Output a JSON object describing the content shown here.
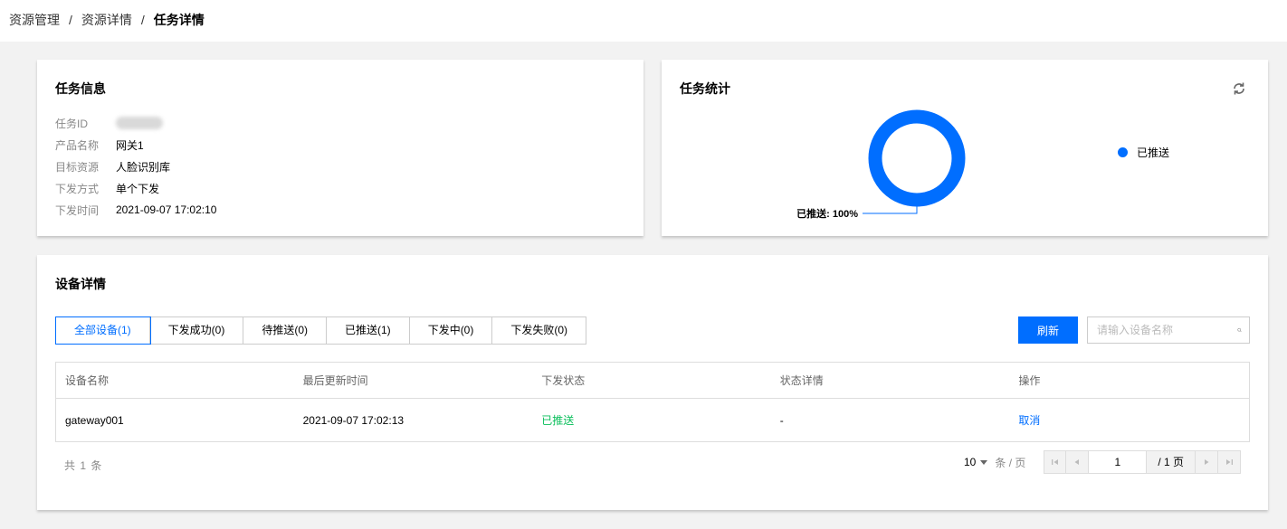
{
  "breadcrumb": {
    "items": [
      "资源管理",
      "资源详情"
    ],
    "separator": "/",
    "current": "任务详情"
  },
  "task_info": {
    "title": "任务信息",
    "fields": [
      {
        "label": "任务ID",
        "value": ""
      },
      {
        "label": "产品名称",
        "value": "网关1"
      },
      {
        "label": "目标资源",
        "value": "人脸识别库"
      },
      {
        "label": "下发方式",
        "value": "单个下发"
      },
      {
        "label": "下发时间",
        "value": "2021-09-07 17:02:10"
      }
    ]
  },
  "task_stats": {
    "title": "任务统计",
    "refresh_icon": "refresh-icon",
    "chart_data": {
      "type": "pie",
      "categories": [
        "已推送"
      ],
      "values": [
        100
      ],
      "data_labels": [
        "已推送: 100%"
      ],
      "legend": [
        "已推送"
      ],
      "legend_position": "right",
      "colors": [
        "#006eff"
      ]
    }
  },
  "device_details": {
    "title": "设备详情",
    "tabs": [
      {
        "label": "全部设备(1)",
        "active": true
      },
      {
        "label": "下发成功(0)",
        "active": false
      },
      {
        "label": "待推送(0)",
        "active": false
      },
      {
        "label": "已推送(1)",
        "active": false
      },
      {
        "label": "下发中(0)",
        "active": false
      },
      {
        "label": "下发失败(0)",
        "active": false
      }
    ],
    "refresh_label": "刷新",
    "search_placeholder": "请输入设备名称",
    "table": {
      "headers": [
        "设备名称",
        "最后更新时间",
        "下发状态",
        "状态详情",
        "操作"
      ],
      "rows": [
        {
          "name": "gateway001",
          "updated": "2021-09-07 17:02:13",
          "status": "已推送",
          "detail": "-",
          "action": "取消"
        }
      ]
    },
    "total_text": "共 1 条",
    "pagination": {
      "page_size": "10",
      "per_page": "条 / 页",
      "current_page": "1",
      "total_pages": "/ 1 页"
    }
  },
  "colors": {
    "primary": "#006eff",
    "success": "#0abf5b"
  }
}
